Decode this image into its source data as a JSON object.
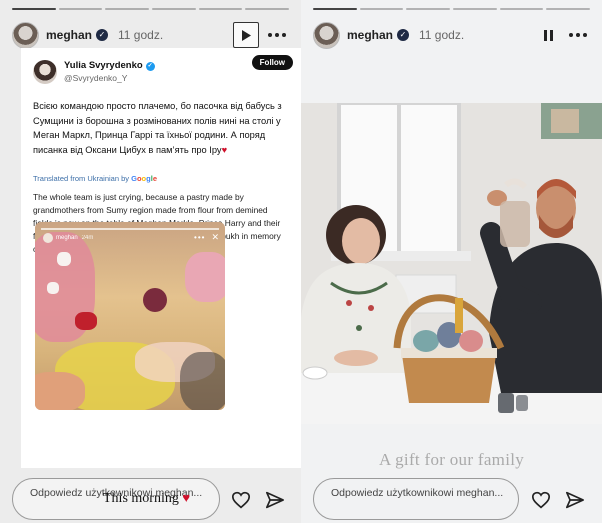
{
  "stories": [
    {
      "username": "meghan",
      "time": "11 godz.",
      "progress_segments": 6,
      "progress_done": 1,
      "control": "play",
      "tweet": {
        "name": "Yulia Svyrydenko",
        "handle": "@Svyrydenko_Y",
        "follow_label": "Follow",
        "text": "Всією командою просто плачемо, бо пасочка від бабусь з Сумщини із борошна з розмінованих полів нині на столі у Меган Маркл, Принца Гаррі та їхньої родини. А поряд писанка від Оксани Цибух в пам’ять про Іру",
        "translated_label": "Translated from Ukrainian by",
        "translated_brand": "Google",
        "translation": "The whole team is just crying, because a pastry made by grandmothers from Sumy region made from flour from demined fields is now on the table of Meghan Markle, Prince Harry and their family. And next to it is a pysanka from Oksana Tsybukh in memory of Ira",
        "embed": {
          "username": "meghan",
          "time": "24m"
        }
      },
      "caption": "This morning",
      "reply_placeholder": "Odpowiedz użytkownikowi meghan..."
    },
    {
      "username": "meghan",
      "time": "11 godz.",
      "progress_segments": 6,
      "progress_done": 1,
      "control": "pause",
      "caption": "A gift for our family",
      "reply_placeholder": "Odpowiedz użytkownikowi meghan..."
    }
  ],
  "colors": {
    "heart": "#d0102b",
    "verified": "#1d9bf0"
  },
  "icons": [
    "play-icon",
    "pause-icon",
    "more-icon",
    "heart-icon",
    "send-icon",
    "verified-icon"
  ]
}
